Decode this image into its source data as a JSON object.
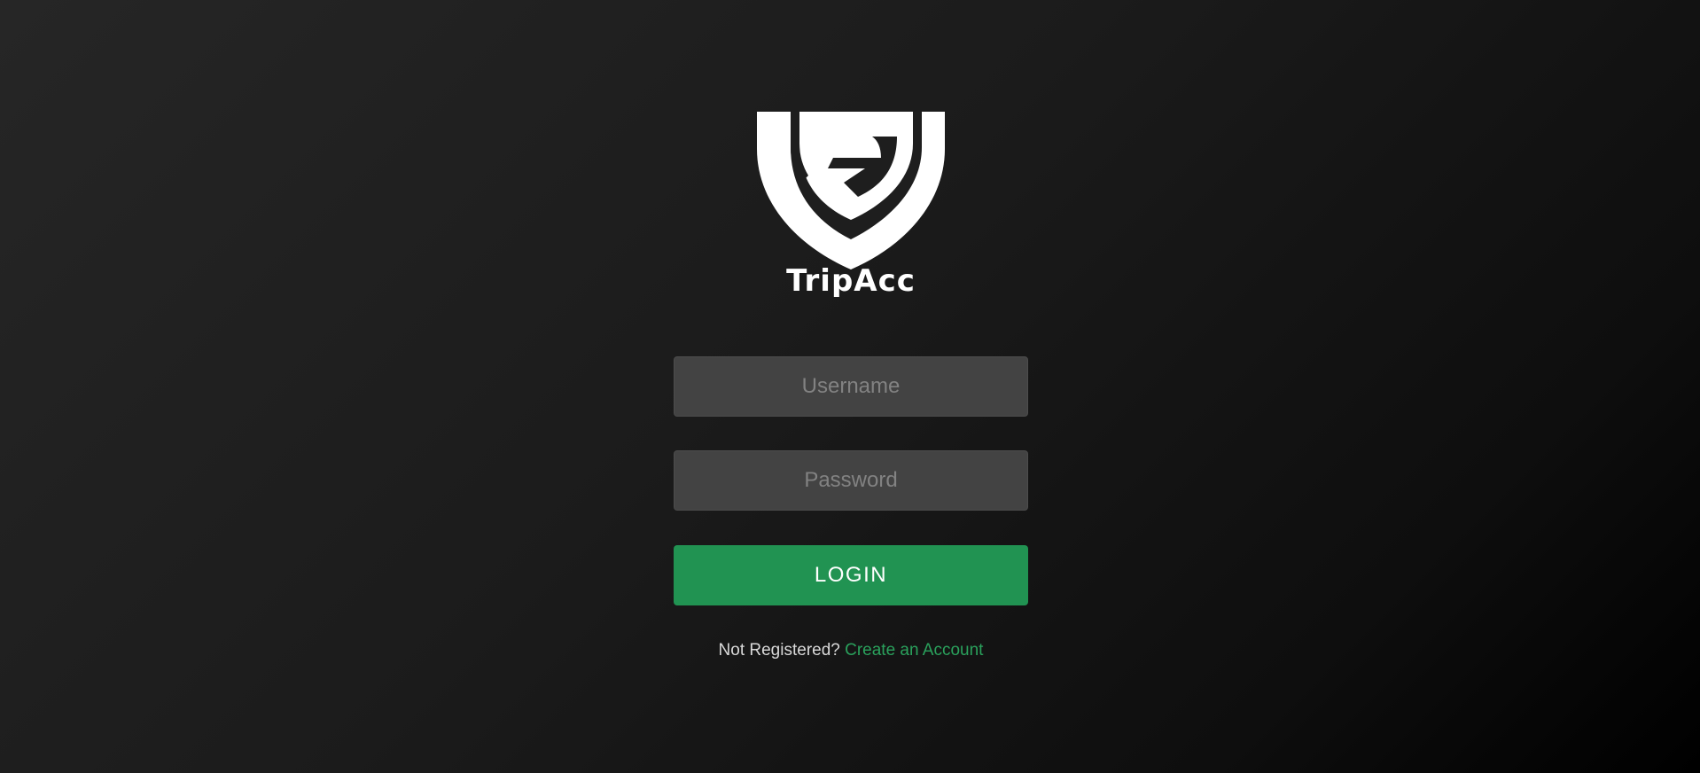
{
  "brand": {
    "name": "TripAcc",
    "logo_icon": "shield-g-logo-icon"
  },
  "login_form": {
    "username_placeholder": "Username",
    "password_placeholder": "Password",
    "login_label": "LOGIN"
  },
  "register": {
    "prompt": "Not Registered?",
    "link_label": "Create an Account"
  },
  "colors": {
    "accent": "#219352",
    "link": "#2aa15c",
    "field_bg": "#434343",
    "background": "#1b1b1b"
  }
}
